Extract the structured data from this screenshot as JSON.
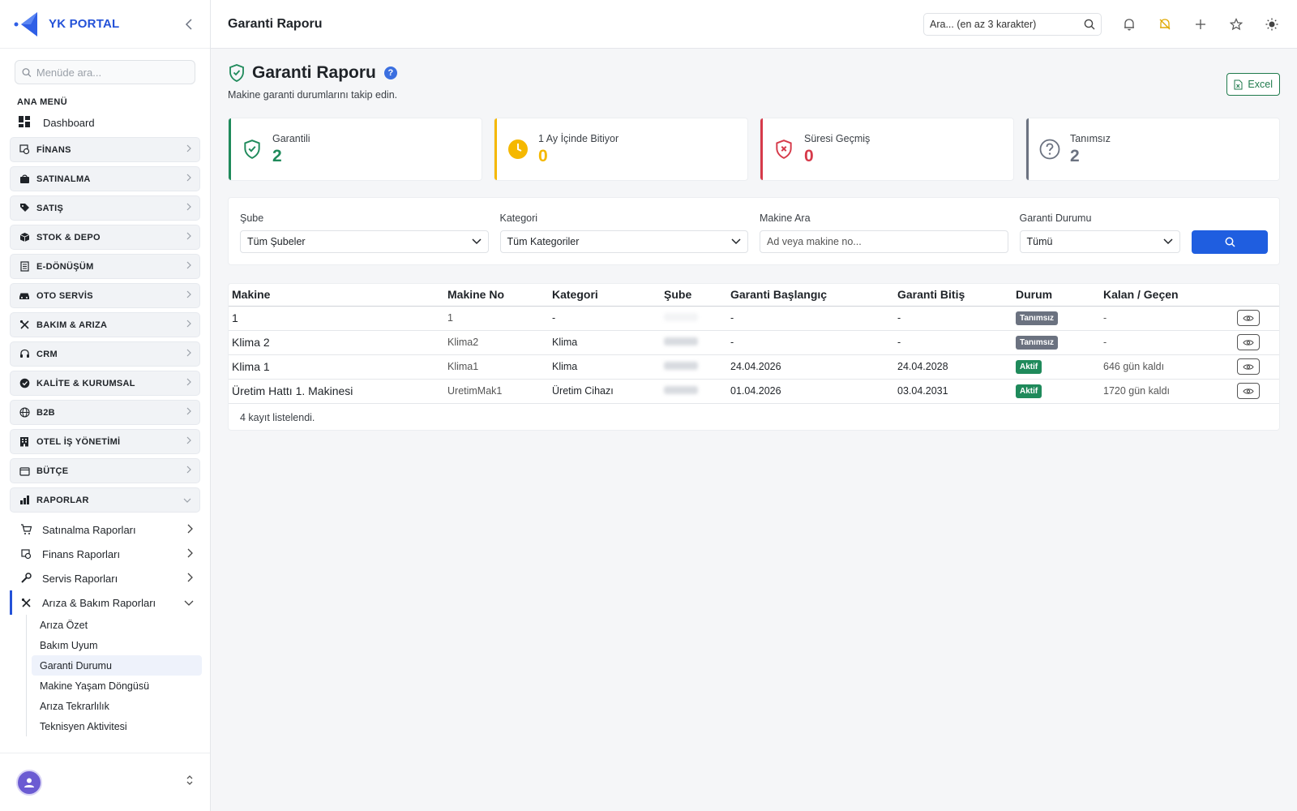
{
  "brand": {
    "name": "YK PORTAL"
  },
  "sidebar": {
    "search_placeholder": "Menüde ara...",
    "section_title": "ANA MENÜ",
    "dashboard_label": "Dashboard",
    "groups": [
      {
        "label": "FİNANS",
        "icon": "finance-icon"
      },
      {
        "label": "SATINALMA",
        "icon": "bag-icon"
      },
      {
        "label": "SATIŞ",
        "icon": "tag-icon"
      },
      {
        "label": "STOK & DEPO",
        "icon": "box-icon"
      },
      {
        "label": "E-DÖNÜŞÜM",
        "icon": "document-icon"
      },
      {
        "label": "OTO SERVİS",
        "icon": "car-icon"
      },
      {
        "label": "BAKIM & ARIZA",
        "icon": "tools-icon"
      },
      {
        "label": "CRM",
        "icon": "headset-icon"
      },
      {
        "label": "KALİTE & KURUMSAL",
        "icon": "badge-check-icon"
      },
      {
        "label": "B2B",
        "icon": "globe-icon"
      },
      {
        "label": "OTEL İŞ YÖNETİMİ",
        "icon": "building-icon"
      },
      {
        "label": "BÜTÇE",
        "icon": "wallet-icon"
      },
      {
        "label": "RAPORLAR",
        "icon": "bar-chart-icon"
      }
    ],
    "report_items": [
      {
        "label": "Satınalma Raporları"
      },
      {
        "label": "Finans Raporları"
      },
      {
        "label": "Servis Raporları"
      },
      {
        "label": "Arıza & Bakım Raporları"
      }
    ],
    "leaves": [
      {
        "label": "Arıza Özet"
      },
      {
        "label": "Bakım Uyum"
      },
      {
        "label": "Garanti Durumu"
      },
      {
        "label": "Makine Yaşam Döngüsü"
      },
      {
        "label": "Arıza Tekrarlılık"
      },
      {
        "label": "Teknisyen Aktivitesi"
      }
    ]
  },
  "topbar": {
    "title": "Garanti Raporu",
    "search_placeholder": "Ara... (en az 3 karakter)"
  },
  "page": {
    "title": "Garanti Raporu",
    "help": "?",
    "subtitle": "Makine garanti durumlarını takip edin.",
    "excel_label": "Excel"
  },
  "stats": [
    {
      "label": "Garantili",
      "value": "2",
      "color": "#1f8a5b"
    },
    {
      "label": "1 Ay İçinde Bitiyor",
      "value": "0",
      "color": "#f5b800"
    },
    {
      "label": "Süresi Geçmiş",
      "value": "0",
      "color": "#d63a4a"
    },
    {
      "label": "Tanımsız",
      "value": "2",
      "color": "#6b7280"
    }
  ],
  "filters": {
    "branch_label": "Şube",
    "branch_value": "Tüm Şubeler",
    "category_label": "Kategori",
    "category_value": "Tüm Kategoriler",
    "machine_label": "Makine Ara",
    "machine_placeholder": "Ad veya makine no...",
    "status_label": "Garanti Durumu",
    "status_value": "Tümü"
  },
  "table": {
    "headers": [
      "Makine",
      "Makine No",
      "Kategori",
      "Şube",
      "Garanti Başlangıç",
      "Garanti Bitiş",
      "Durum",
      "Kalan / Geçen"
    ],
    "rows": [
      {
        "name": "1",
        "code": "1",
        "category": "-",
        "start": "-",
        "end": "-",
        "status": "Tanımsız",
        "status_color": "#6b7280",
        "remaining": "-"
      },
      {
        "name": "Klima 2",
        "code": "Klima2",
        "category": "Klima",
        "start": "-",
        "end": "-",
        "status": "Tanımsız",
        "status_color": "#6b7280",
        "remaining": "-"
      },
      {
        "name": "Klima 1",
        "code": "Klima1",
        "category": "Klima",
        "start": "24.04.2026",
        "end": "24.04.2028",
        "status": "Aktif",
        "status_color": "#1f8a5b",
        "remaining": "646 gün kaldı"
      },
      {
        "name": "Üretim Hattı 1. Makinesi",
        "code": "UretimMak1",
        "category": "Üretim Cihazı",
        "start": "01.04.2026",
        "end": "03.04.2031",
        "status": "Aktif",
        "status_color": "#1f8a5b",
        "remaining": "1720 gün kaldı"
      }
    ],
    "footer": "4 kayıt listelendi."
  },
  "colors": {
    "primary": "#2452d8",
    "button": "#1f5ee0",
    "excel": "#1f7a4c"
  }
}
